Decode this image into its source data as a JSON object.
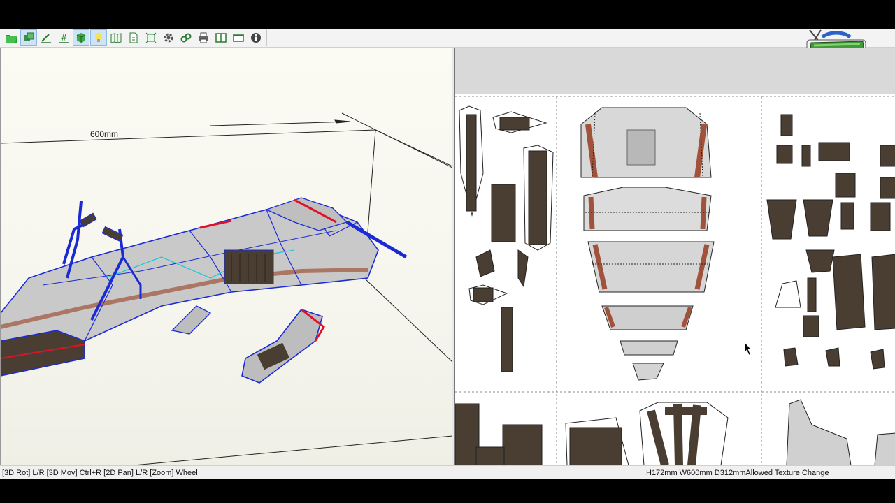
{
  "toolbar": {
    "icons": [
      "open-folder-icon",
      "texture-toggle-icon",
      "edge-draw-icon",
      "number-icon",
      "cube-3d-icon",
      "lightbulb-icon",
      "book-unfold-icon",
      "page-icon",
      "flap-icon",
      "settings-icon",
      "link-icon",
      "print-icon",
      "split-view-icon",
      "window-icon",
      "info-icon"
    ]
  },
  "view3d": {
    "dimension_label": "600mm"
  },
  "statusbar": {
    "controls_hint": "[3D Rot] L/R [3D Mov] Ctrl+R [2D Pan] L/R [Zoom] Wheel",
    "model_info": "H172mm W600mm D312mmAllowed Texture Change"
  },
  "colors": {
    "wire_blue": "#1a2bd6",
    "cut_red": "#e0122a",
    "fold_cyan": "#22c8d8",
    "part_dark": "#4a3e32"
  }
}
